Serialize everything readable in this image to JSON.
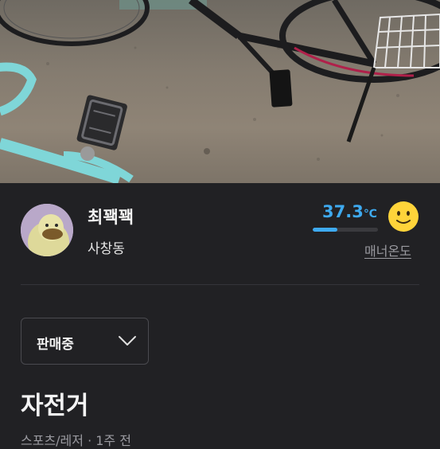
{
  "seller": {
    "nickname": "최꽥꽥",
    "region": "사창동",
    "temperature": "37.3",
    "temperature_unit": "℃",
    "temperature_level": 0.373,
    "manner_label": "매너온도",
    "temperature_color": "#3eaaf0"
  },
  "status_select": {
    "selected": "판매중"
  },
  "product": {
    "title": "자전거",
    "meta": "스포츠/레저 · 1주 전"
  },
  "icons": {
    "avatar": "duck-avatar",
    "temperature_face": "smiley-face-icon",
    "dropdown": "chevron-down-icon"
  }
}
